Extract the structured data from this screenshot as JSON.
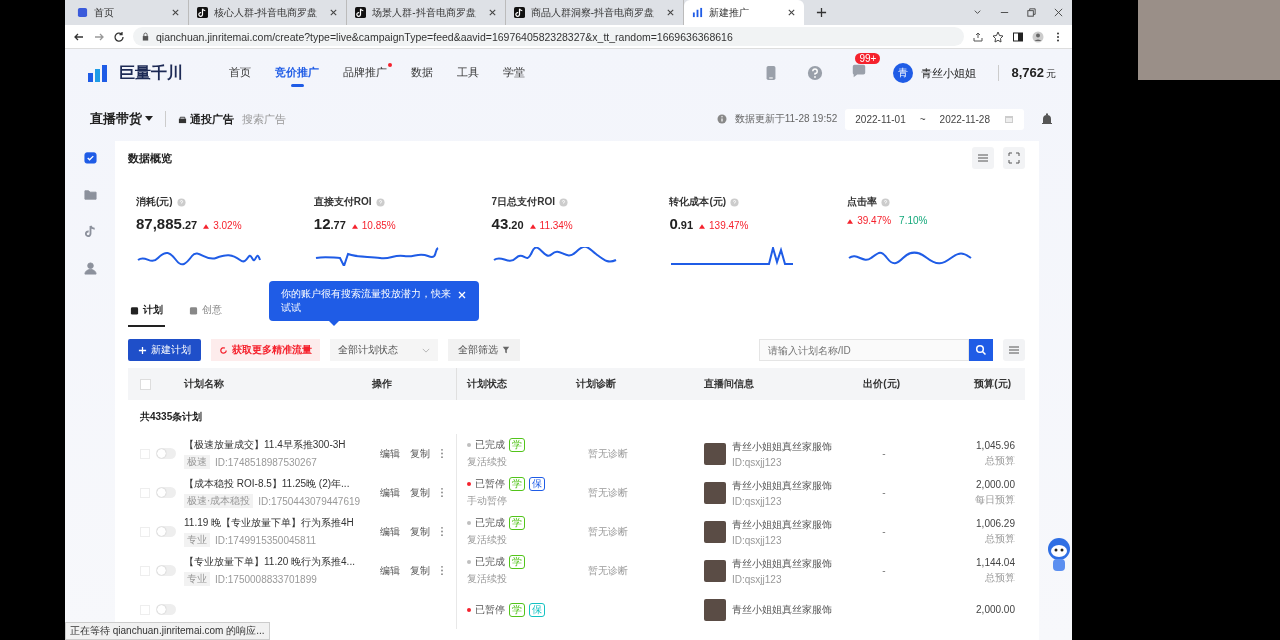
{
  "browser": {
    "tabs": [
      {
        "title": "首页",
        "selected": false
      },
      {
        "title": "核心人群-抖音电商罗盘",
        "selected": false
      },
      {
        "title": "场景人群-抖音电商罗盘",
        "selected": false
      },
      {
        "title": "商品人群洞察-抖音电商罗盘",
        "selected": false
      },
      {
        "title": "新建推广",
        "selected": true
      }
    ],
    "url": "qianchuan.jinritemai.com/create?type=live&campaignType=feed&aavid=1697640582328327&x_tt_random=1669636368616",
    "status": "正在等待 qianchuan.jinritemai.com 的响应..."
  },
  "header": {
    "logo": "巨量千川",
    "nav": [
      {
        "label": "首页",
        "selected": false,
        "dot": false
      },
      {
        "label": "竞价推广",
        "selected": true,
        "dot": false
      },
      {
        "label": "品牌推广",
        "selected": false,
        "dot": true
      },
      {
        "label": "数据",
        "selected": false,
        "dot": false
      },
      {
        "label": "工具",
        "selected": false,
        "dot": false
      },
      {
        "label": "学堂",
        "selected": false,
        "dot": false
      }
    ],
    "messages_badge": "99+",
    "avatar": "青",
    "user": "青丝小姐姐",
    "balance": "8,762",
    "balance_unit": "元"
  },
  "subheader": {
    "mode": "直播带货",
    "ad_types": [
      {
        "label": "通投广告",
        "selected": true
      },
      {
        "label": "搜索广告",
        "selected": false
      }
    ],
    "updated": "数据更新于11-28 19:52",
    "date_from": "2022-11-01",
    "date_sep": "~",
    "date_to": "2022-11-28"
  },
  "sidebar": [
    {
      "selected": true
    },
    {
      "selected": false
    },
    {
      "selected": false
    },
    {
      "selected": false
    }
  ],
  "overview": {
    "title": "数据概览",
    "metrics": [
      {
        "label": "消耗(元)",
        "value": "87,885",
        "decimals": ".27",
        "changes": [
          {
            "text": "3.02%",
            "kind": "up"
          }
        ]
      },
      {
        "label": "直接支付ROI",
        "value": "12",
        "decimals": ".77",
        "changes": [
          {
            "text": "10.85%",
            "kind": "up"
          }
        ]
      },
      {
        "label": "7日总支付ROI",
        "value": "43",
        "decimals": ".20",
        "changes": [
          {
            "text": "11.34%",
            "kind": "up"
          }
        ]
      },
      {
        "label": "转化成本(元)",
        "value": "0",
        "decimals": ".91",
        "changes": [
          {
            "text": "139.47%",
            "kind": "up"
          }
        ]
      },
      {
        "label": "点击率",
        "changes": [
          {
            "text": "39.47%",
            "kind": "up"
          },
          {
            "text": "7.10%",
            "kind": "plain"
          }
        ]
      }
    ]
  },
  "tooltip": "你的账户很有搜索流量投放潜力，快来试试",
  "tabs": [
    {
      "label": "计划",
      "selected": true
    },
    {
      "label": "创意",
      "selected": false
    }
  ],
  "toolbar": {
    "new_button": "新建计划",
    "traffic_link": "获取更多精准流量",
    "status_filter": "全部计划状态",
    "all_filter": "全部筛选",
    "search_placeholder": "请输入计划名称/ID"
  },
  "table": {
    "select_all": {
      "checked": false
    },
    "columns": [
      "计划名称",
      "操作",
      "计划状态",
      "计划诊断",
      "直播间信息",
      "出价(元)",
      "预算(元)"
    ],
    "summary": "共4335条计划",
    "rows": [
      {
        "selected": false,
        "on": false,
        "name": "【极速放量成交】11.4早系推300-3H",
        "tag": "极速",
        "id": "ID:1748518987530267",
        "actions": [
          "编辑",
          "复制"
        ],
        "status": {
          "label": "已完成",
          "color": "#bfbfbf"
        },
        "badges": [
          {
            "label": "学",
            "color": "#52c41a"
          }
        ],
        "substatus": "复活续投",
        "diagnosis": "暂无诊断",
        "room": "青丝小姐姐真丝家服饰",
        "room_id": "ID:qsxjj123",
        "bid": "-",
        "budget": "1,045.96",
        "budget_type": "总预算"
      },
      {
        "selected": false,
        "on": false,
        "name": "【成本稳投 ROI-8.5】11.25晚 (2)年...",
        "tag": "极速·成本稳投",
        "id": "ID:1750443079447619",
        "actions": [
          "编辑",
          "复制"
        ],
        "status": {
          "label": "已暂停",
          "color": "#f5222d"
        },
        "badges": [
          {
            "label": "学",
            "color": "#52c41a"
          },
          {
            "label": "保",
            "color": "#1f5ce6"
          }
        ],
        "substatus": "手动暂停",
        "diagnosis": "暂无诊断",
        "room": "青丝小姐姐真丝家服饰",
        "room_id": "ID:qsxjj123",
        "bid": "-",
        "budget": "2,000.00",
        "budget_type": "每日预算"
      },
      {
        "selected": false,
        "on": false,
        "name": "11.19 晚【专业放量下单】行为系推4H",
        "tag": "专业",
        "id": "ID:1749915350045811",
        "actions": [
          "编辑",
          "复制"
        ],
        "status": {
          "label": "已完成",
          "color": "#bfbfbf"
        },
        "badges": [
          {
            "label": "学",
            "color": "#52c41a"
          }
        ],
        "substatus": "复活续投",
        "diagnosis": "暂无诊断",
        "room": "青丝小姐姐真丝家服饰",
        "room_id": "ID:qsxjj123",
        "bid": "-",
        "budget": "1,006.29",
        "budget_type": "总预算"
      },
      {
        "selected": false,
        "on": false,
        "name": "【专业放量下单】11.20 晚行为系推4...",
        "tag": "专业",
        "id": "ID:1750008833701899",
        "actions": [
          "编辑",
          "复制"
        ],
        "status": {
          "label": "已完成",
          "color": "#bfbfbf"
        },
        "badges": [
          {
            "label": "学",
            "color": "#52c41a"
          }
        ],
        "substatus": "复活续投",
        "diagnosis": "暂无诊断",
        "room": "青丝小姐姐真丝家服饰",
        "room_id": "ID:qsxjj123",
        "bid": "-",
        "budget": "1,144.04",
        "budget_type": "总预算"
      },
      {
        "selected": false,
        "on": false,
        "status": {
          "label": "已暂停",
          "color": "#f5222d"
        },
        "badges": [
          {
            "label": "学",
            "color": "#52c41a"
          },
          {
            "label": "保",
            "color": "#13c2c2"
          }
        ],
        "room": "青丝小姐姐真丝家服饰",
        "budget": "2,000.00"
      }
    ]
  }
}
